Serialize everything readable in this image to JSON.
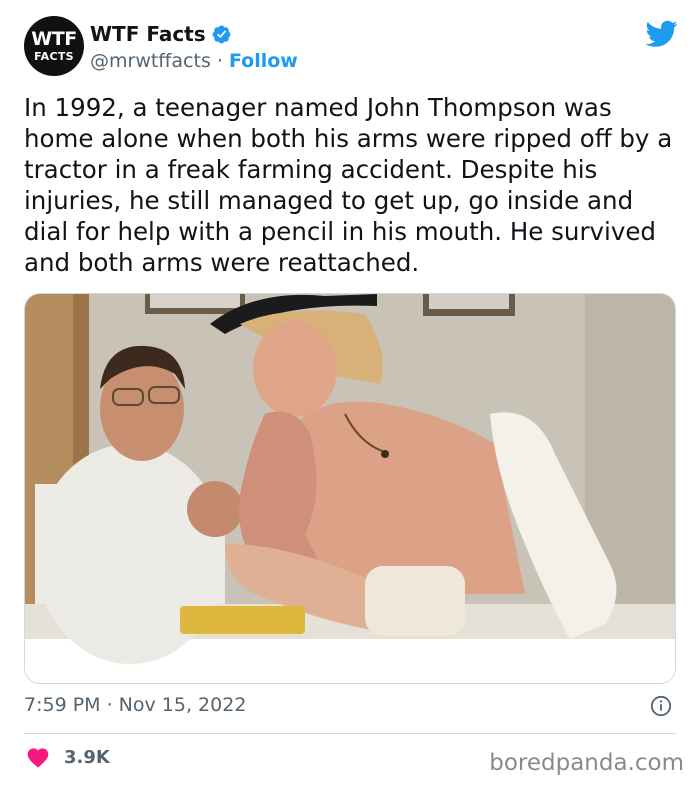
{
  "tweet": {
    "avatar_line1": "WTF",
    "avatar_line2": "FACTS",
    "display_name": "WTF Facts",
    "handle": "@mrwtffacts",
    "separator": " · ",
    "follow_label": "Follow",
    "text": "In 1992, a teenager named John Thompson was home alone when both his arms were ripped off by a tractor in a freak farming accident. Despite his injuries, he still managed to get up, go inside and dial for help with a pencil in his mouth. He survived and both arms were reattached.",
    "timestamp": "7:59 PM · Nov 15, 2022",
    "like_count": "3.9K"
  },
  "watermark": "boredpanda.com",
  "colors": {
    "accent": "#1d9bf0",
    "text": "#0f1419",
    "muted": "#536471",
    "heart": "#f91880",
    "border": "#cfd9de"
  },
  "icons": [
    "verified-badge-icon",
    "twitter-bird-icon",
    "info-icon",
    "heart-icon"
  ]
}
